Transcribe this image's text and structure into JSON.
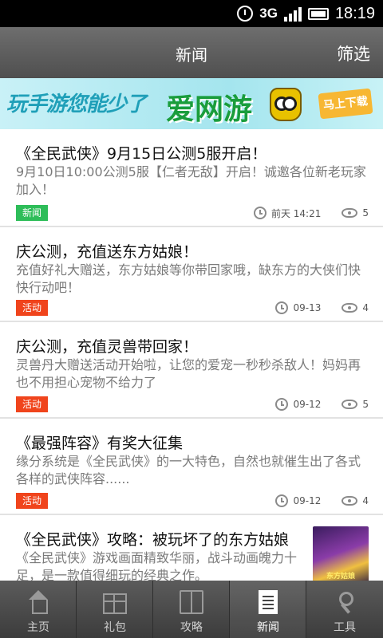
{
  "status_bar": {
    "network": "3G",
    "time": "18:19"
  },
  "header": {
    "title": "新闻",
    "filter_label": "筛选"
  },
  "banner": {
    "slogan": "玩手游您能少了",
    "brand": "爱网游",
    "download_label": "马上下载"
  },
  "articles": [
    {
      "title": "《全民武侠》9月15日公测5服开启！",
      "summary": "9月10日10:00公测5服【仁者无敌】开启！诚邀各位新老玩家加入！",
      "tag": "新闻",
      "tag_color": "#2ebd59",
      "time": "前天 14:21",
      "views": "5"
    },
    {
      "title": "庆公测，充值送东方姑娘！",
      "summary": "充值好礼大赠送，东方姑娘等你带回家哦，缺东方的大侠们快快行动吧！",
      "tag": "活动",
      "tag_color": "#f0441c",
      "time": "09-13",
      "views": "4"
    },
    {
      "title": "庆公测，充值灵兽带回家！",
      "summary": "灵兽丹大赠送活动开始啦，让您的爱宠一秒秒杀敌人！妈妈再也不用担心宠物不给力了",
      "tag": "活动",
      "tag_color": "#f0441c",
      "time": "09-12",
      "views": "5"
    },
    {
      "title": "《最强阵容》有奖大征集",
      "summary": "缘分系统是《全民武侠》的一大特色，自然也就催生出了各式各样的武侠阵容......",
      "tag": "活动",
      "tag_color": "#f0441c",
      "time": "09-12",
      "views": "4"
    },
    {
      "title": "《全民武侠》攻略：被玩坏了的东方姑娘",
      "summary": "《全民武侠》游戏画面精致华丽，战斗动画魄力十足，是一款值得细玩的经典之作。",
      "thumb_caption": "东方姑娘"
    }
  ],
  "bottom_nav": [
    {
      "label": "主页",
      "icon": "home-icon",
      "active": false
    },
    {
      "label": "礼包",
      "icon": "gift-icon",
      "active": false
    },
    {
      "label": "攻略",
      "icon": "book-icon",
      "active": false
    },
    {
      "label": "新闻",
      "icon": "news-icon",
      "active": true
    },
    {
      "label": "工具",
      "icon": "tool-icon",
      "active": false
    }
  ]
}
